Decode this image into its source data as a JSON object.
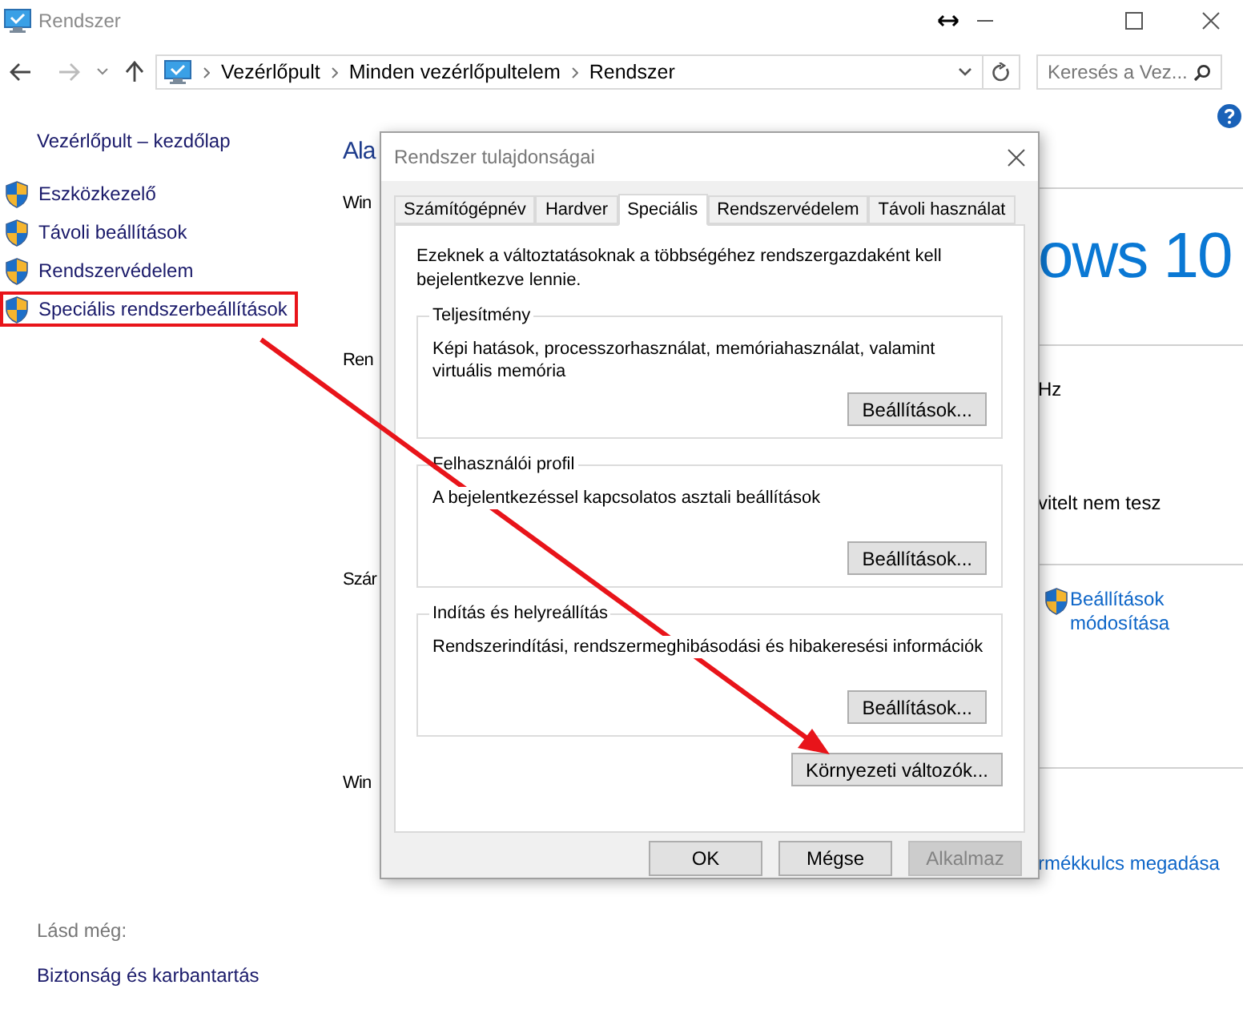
{
  "window": {
    "title": "Rendszer"
  },
  "address_bar": {
    "breadcrumb": [
      "Vezérlőpult",
      "Minden vezérlőpultelem",
      "Rendszer"
    ]
  },
  "search": {
    "placeholder": "Keresés a Vez..."
  },
  "sidebar": {
    "home": "Vezérlőpult – kezdőlap",
    "items": [
      {
        "label": "Eszközkezelő",
        "highlighted": false
      },
      {
        "label": "Távoli beállítások",
        "highlighted": false
      },
      {
        "label": "Rendszervédelem",
        "highlighted": false
      },
      {
        "label": "Speciális rendszerbeállítások",
        "highlighted": true
      }
    ],
    "see_also_title": "Lásd még:",
    "see_also": [
      "Biztonság és karbantartás"
    ]
  },
  "main": {
    "heading": "Ala",
    "sections": [
      {
        "label": "Win",
        "kind": "logo",
        "texts": [
          "ows 10"
        ]
      },
      {
        "label": "Ren",
        "kind": "lines",
        "texts": [
          "Hz",
          "vitelt nem tesz"
        ]
      },
      {
        "label": "Szár",
        "kind": "shield_link",
        "texts": [
          "Beállítások módosítása"
        ]
      },
      {
        "label": "Win",
        "kind": "link",
        "texts": [
          "rmékkulcs megadása"
        ]
      }
    ]
  },
  "dialog": {
    "title": "Rendszer tulajdonságai",
    "tabs": [
      {
        "label": "Számítógépnév",
        "selected": false
      },
      {
        "label": "Hardver",
        "selected": false
      },
      {
        "label": "Speciális",
        "selected": true
      },
      {
        "label": "Rendszervédelem",
        "selected": false
      },
      {
        "label": "Távoli használat",
        "selected": false
      }
    ],
    "notice": "Ezeknek a változtatásoknak a többségéhez rendszergazdaként kell bejelentkezve lennie.",
    "groups": [
      {
        "title": "Teljesítmény",
        "description": "Képi hatások, processzorhasználat, memóriahasználat, valamint virtuális memória",
        "button": "Beállítások..."
      },
      {
        "title": "Felhasználói profil",
        "description": "A bejelentkezéssel kapcsolatos asztali beállítások",
        "button": "Beállítások..."
      },
      {
        "title": "Indítás és helyreállítás",
        "description": "Rendszerindítási, rendszermeghibásodási és hibakeresési információk",
        "button": "Beállítások..."
      }
    ],
    "env_button": "Környezeti változók...",
    "buttons": [
      {
        "label": "OK",
        "disabled": false
      },
      {
        "label": "Mégse",
        "disabled": false
      },
      {
        "label": "Alkalmaz",
        "disabled": true
      }
    ]
  }
}
